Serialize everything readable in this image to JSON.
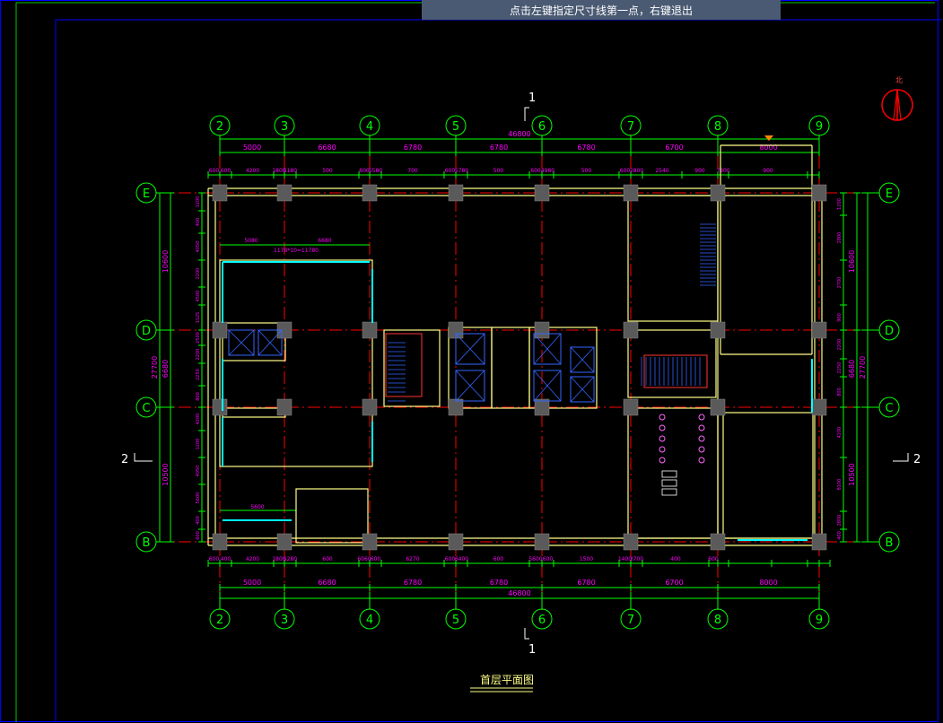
{
  "command_prompt": "点击左键指定尺寸线第一点，右键退出",
  "drawing_title": "首层平面图",
  "north_label": "北",
  "section_label": "1",
  "section2_label": "2",
  "colors": {
    "background": "#000000",
    "frame": "#0000ff",
    "axis": "#ff0000",
    "dimension": "#00ff00",
    "dim_text": "#ff00ff",
    "wall": "#ffff88",
    "window": "#00ffff",
    "column": "#5a5a5a",
    "elevator": "#0000cc",
    "prompt_bg": "#4a5a73"
  },
  "grid_columns": [
    "2",
    "3",
    "4",
    "5",
    "6",
    "7",
    "8",
    "9"
  ],
  "grid_rows": [
    "E",
    "D",
    "C",
    "B"
  ],
  "overall_length": "46800",
  "top_spans": [
    "5000",
    "6680",
    "6780",
    "6780",
    "6780",
    "6700",
    "8000"
  ],
  "bottom_spans": [
    "5000",
    "6680",
    "6780",
    "6780",
    "6780",
    "6700",
    "8000"
  ],
  "top_sub_dims": [
    "600",
    "600",
    "4200",
    "1800",
    "5180",
    "500",
    "600",
    "5580",
    "700",
    "600",
    "5780",
    "500",
    "600",
    "4980",
    "500",
    "600",
    "2800",
    "2540",
    "900",
    "7800",
    "900"
  ],
  "bottom_sub_dims": [
    "600",
    "400",
    "4200",
    "1800",
    "5280",
    "600",
    "6060",
    "600",
    "6270",
    "600",
    "6400",
    "600",
    "5600",
    "600",
    "1500",
    "1400",
    "3700",
    "400",
    "600"
  ],
  "left_dims": [
    "10600",
    "6680",
    "10500"
  ],
  "left_total": "27700",
  "right_dims": [
    "10600",
    "6680",
    "10500"
  ],
  "right_total": "27700",
  "room_dims": {
    "room_top_width1": "5080",
    "room_top_width2": "6680",
    "room_note": "1178*10=11780",
    "stair_dim": "5600"
  }
}
